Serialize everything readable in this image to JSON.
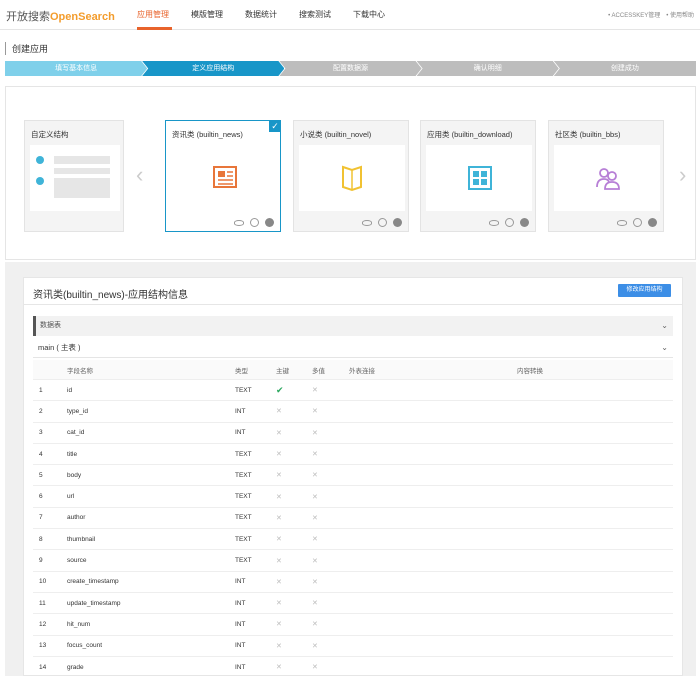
{
  "nav": {
    "logo_prefix": "开放搜索",
    "logo_brand": "OpenSearch",
    "tabs": [
      "应用管理",
      "模版管理",
      "数据统计",
      "搜索测试",
      "下载中心"
    ],
    "links": [
      "• ACCESSKEY管理",
      "• 使用帮助"
    ]
  },
  "page_title": "创建应用",
  "steps": [
    "填写基本信息",
    "定义应用结构",
    "配置数据源",
    "确认明细",
    "创建成功"
  ],
  "templates": {
    "custom": "自定义结构",
    "cards": [
      {
        "title": "资讯类 (builtin_news)",
        "icon": "newspaper-icon",
        "color": "#e8763a",
        "selected": true
      },
      {
        "title": "小说类 (builtin_novel)",
        "icon": "book-icon",
        "color": "#f1c232",
        "selected": false
      },
      {
        "title": "应用类 (builtin_download)",
        "icon": "app-grid-icon",
        "color": "#3fb4d8",
        "selected": false
      },
      {
        "title": "社区类 (builtin_bbs)",
        "icon": "users-icon",
        "color": "#b77fd6",
        "selected": false
      }
    ]
  },
  "structure": {
    "title": "资讯类(builtin_news)-应用结构信息",
    "modify_button": "修改应用结构",
    "section_label": "数据表",
    "table_label": "main ( 主表 )",
    "columns": [
      "字段名称",
      "类型",
      "主键",
      "多值",
      "外表连接",
      "内容转换"
    ],
    "rows": [
      {
        "no": "1",
        "name": "id",
        "type": "TEXT",
        "pk": true
      },
      {
        "no": "2",
        "name": "type_id",
        "type": "INT",
        "pk": false
      },
      {
        "no": "3",
        "name": "cat_id",
        "type": "INT",
        "pk": false
      },
      {
        "no": "4",
        "name": "title",
        "type": "TEXT",
        "pk": false
      },
      {
        "no": "5",
        "name": "body",
        "type": "TEXT",
        "pk": false
      },
      {
        "no": "6",
        "name": "url",
        "type": "TEXT",
        "pk": false
      },
      {
        "no": "7",
        "name": "author",
        "type": "TEXT",
        "pk": false
      },
      {
        "no": "8",
        "name": "thumbnail",
        "type": "TEXT",
        "pk": false
      },
      {
        "no": "9",
        "name": "source",
        "type": "TEXT",
        "pk": false
      },
      {
        "no": "10",
        "name": "create_timestamp",
        "type": "INT",
        "pk": false
      },
      {
        "no": "11",
        "name": "update_timestamp",
        "type": "INT",
        "pk": false
      },
      {
        "no": "12",
        "name": "hit_num",
        "type": "INT",
        "pk": false
      },
      {
        "no": "13",
        "name": "focus_count",
        "type": "INT",
        "pk": false
      },
      {
        "no": "14",
        "name": "grade",
        "type": "INT",
        "pk": false
      }
    ]
  }
}
